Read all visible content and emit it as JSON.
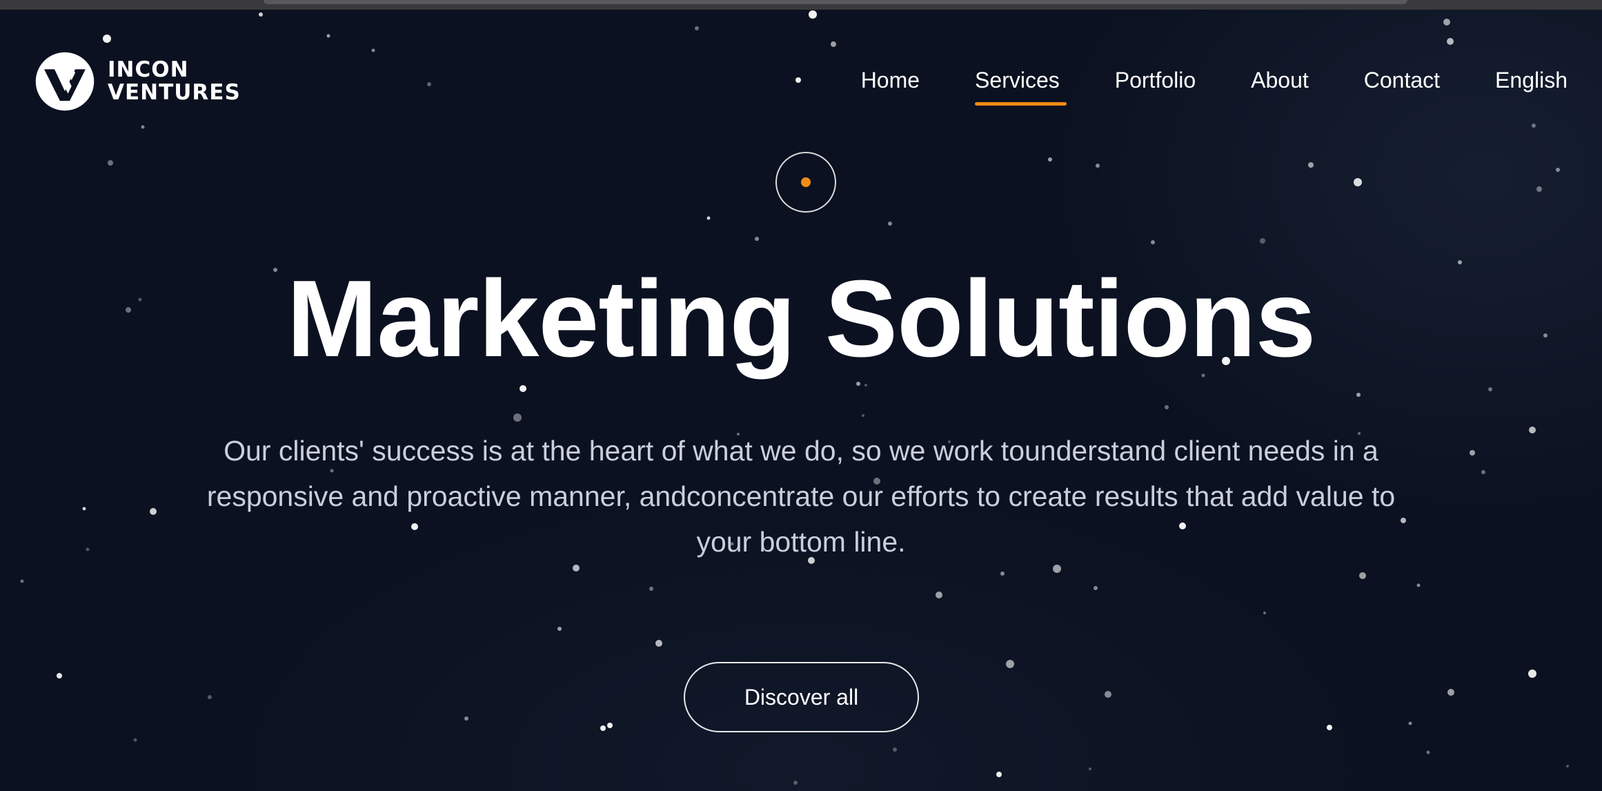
{
  "brand": {
    "line1": "INCON",
    "line2": "VENTURES",
    "icon": "incon-ventures-logo"
  },
  "nav": {
    "items": [
      {
        "label": "Home",
        "active": false
      },
      {
        "label": "Services",
        "active": true
      },
      {
        "label": "Portfolio",
        "active": false
      },
      {
        "label": "About",
        "active": false
      },
      {
        "label": "Contact",
        "active": false
      },
      {
        "label": "English",
        "active": false
      }
    ]
  },
  "hero": {
    "title": "Marketing Solutions",
    "description": "Our clients' success is at the heart of what we do, so we work tounderstand client needs in a responsive and proactive manner, andconcentrate our efforts to create results that add value to your bottom line.",
    "cta_label": "Discover all"
  },
  "colors": {
    "background": "#0b1120",
    "accent": "#f28c18",
    "text": "#ffffff",
    "muted_text": "#c9cfdb"
  }
}
